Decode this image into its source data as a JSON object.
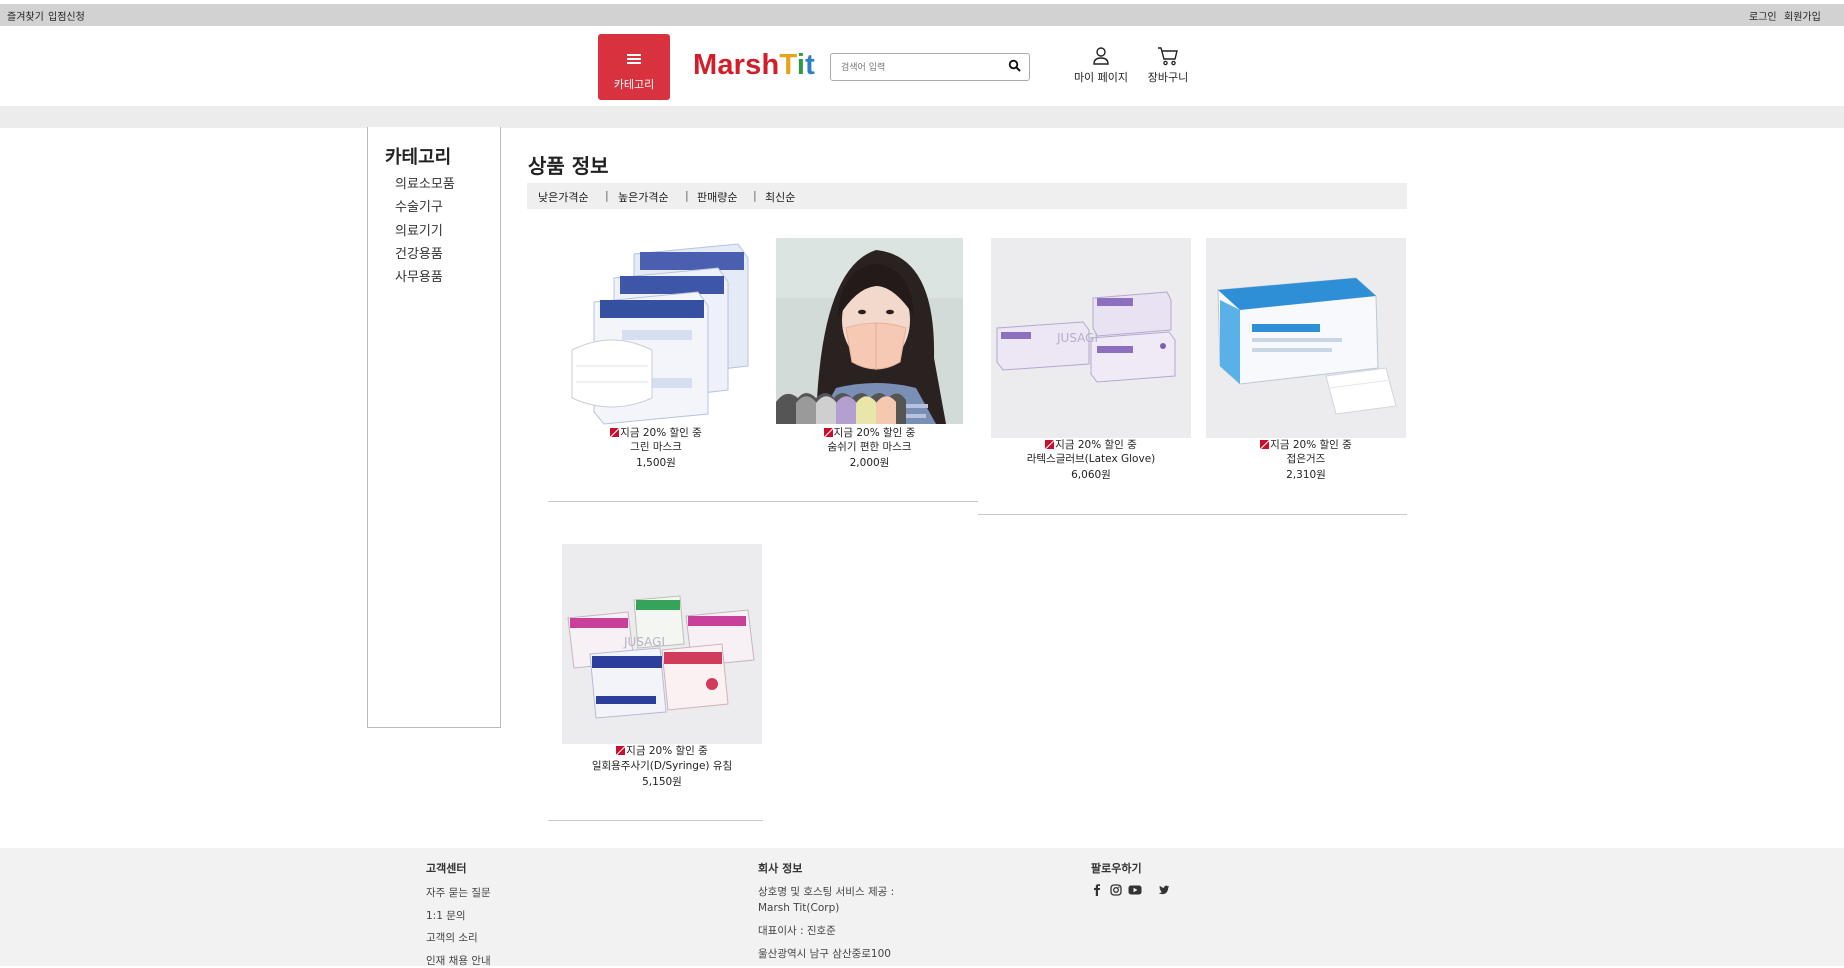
{
  "topbar": {
    "bookmark": "즐겨찾기",
    "store_apply": "입점신청",
    "login": "로그인",
    "signup": "회원가입"
  },
  "header": {
    "category_label": "카테고리",
    "logo_part1": "Marsh",
    "logo_part2": "Tit",
    "search_placeholder": "검색어 입력",
    "mypage": "마이 페이지",
    "cart": "장바구니"
  },
  "sidebar": {
    "title": "카테고리",
    "items": [
      "의료소모품",
      "수술기구",
      "의료기기",
      "건강용품",
      "사무용품"
    ]
  },
  "main": {
    "title": "상품 정보",
    "sort": [
      "낮은가격순",
      "높은가격순",
      "판매량순",
      "최신순"
    ],
    "separator": "|"
  },
  "products": [
    {
      "promo": "지금 20% 할인 중",
      "name": "그린 마스크",
      "price": "1,500원"
    },
    {
      "promo": "지금 20% 할인 중",
      "name": "숨쉬기 편한 마스크",
      "price": "2,000원"
    },
    {
      "promo": "지금 20% 할인 중",
      "name": "라텍스글러브(Latex Glove)",
      "price": "6,060원"
    },
    {
      "promo": "지금 20% 할인 중",
      "name": "접은거즈",
      "price": "2,310원"
    },
    {
      "promo": "지금 20% 할인 중",
      "name": "일회용주사기(D/Syringe) 유침",
      "price": "5,150원"
    }
  ],
  "footer": {
    "support_title": "고객센터",
    "support_links": [
      "자주 묻는 질문",
      "1:1 문의",
      "고객의 소리",
      "인재 채용 안내"
    ],
    "company_title": "회사 정보",
    "company_lines": [
      "상호명 및 호스팅 서비스 제공 :",
      "Marsh Tit(Corp)",
      "대표이사 : 진호준",
      "울산광역시 남구 삼산중로100"
    ],
    "follow_title": "팔로우하기"
  },
  "colors": {
    "accent": "#d8323f",
    "logo_red": "#d21e28"
  }
}
